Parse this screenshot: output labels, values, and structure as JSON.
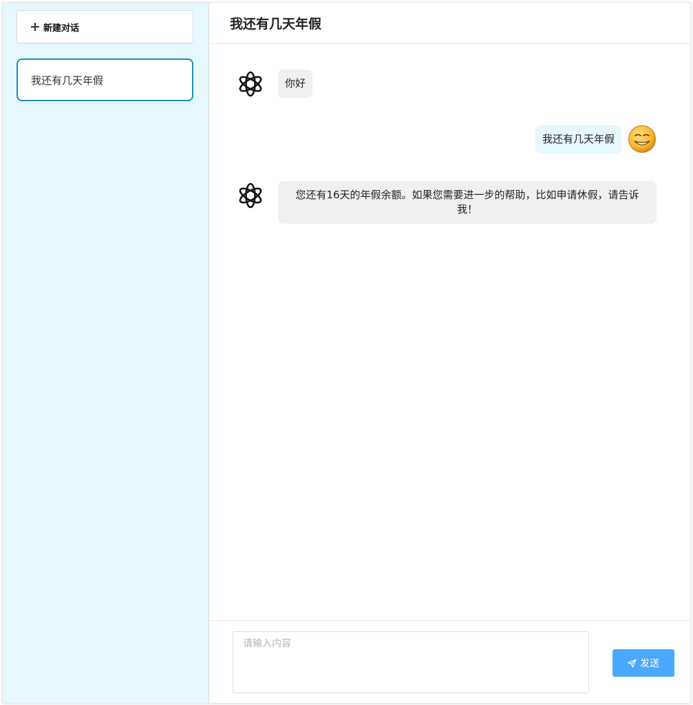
{
  "sidebar": {
    "new_chat_label": "新建对话",
    "conversations": [
      {
        "label": "我还有几天年假"
      }
    ]
  },
  "header": {
    "title": "我还有几天年假"
  },
  "messages": [
    {
      "role": "assistant",
      "text": "你好",
      "avatar": "openai-logo-icon"
    },
    {
      "role": "user",
      "text": "我还有几天年假",
      "avatar": "smiley-face-avatar"
    },
    {
      "role": "assistant",
      "text": "您还有16天的年假余额。如果您需要进一步的帮助，比如申请休假，请告诉我！",
      "avatar": "openai-logo-icon"
    }
  ],
  "composer": {
    "placeholder": "请输入内容",
    "value": "",
    "send_label": "发送"
  },
  "colors": {
    "sidebar_bg": "#e6f7fe",
    "active_border": "#1d8fae",
    "send_button": "#4aa8ff",
    "assistant_bubble": "#f0f0f0",
    "user_bubble": "#e6f7fe"
  }
}
